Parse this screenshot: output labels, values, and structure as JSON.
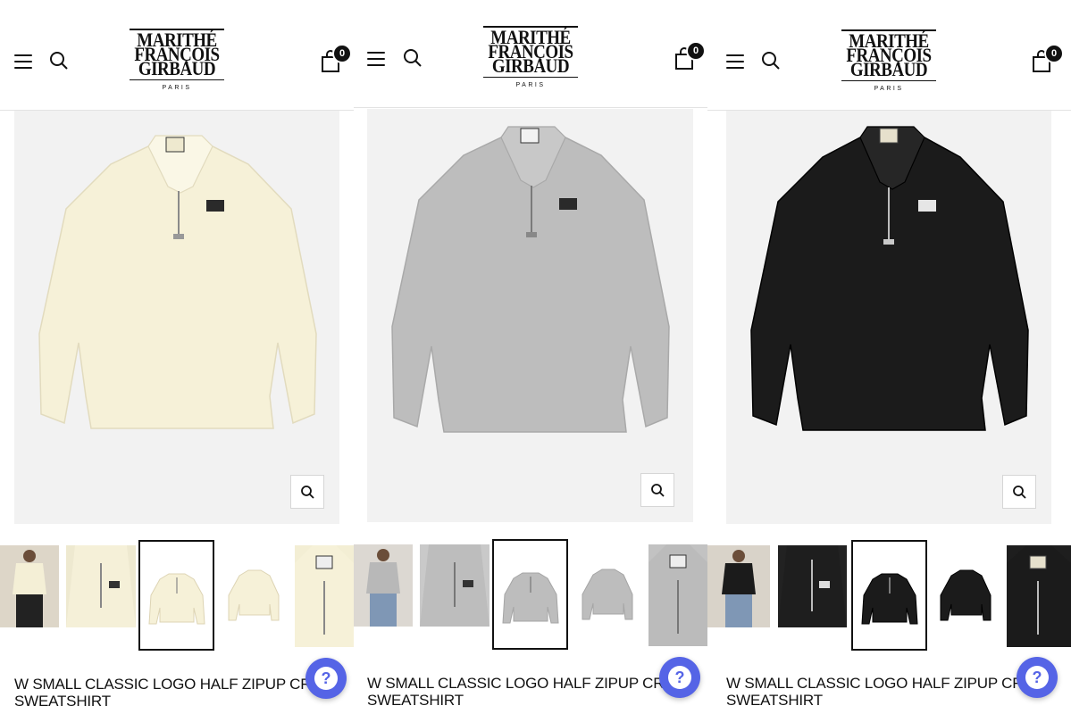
{
  "brand": {
    "line1": "MARITHÉ",
    "line2": "FRANÇOIS",
    "line3": "GIRBAUD",
    "tagline": "PARIS"
  },
  "cart": {
    "count": "0"
  },
  "colors": {
    "accent": "#5564e6",
    "cream": "#f6f1d8",
    "grey": "#b4b4b4",
    "black": "#1b1b1b",
    "image_bg": "#f2f2f2"
  },
  "panels": [
    {
      "variant": "cream",
      "title_line1": "W SMALL CLASSIC LOGO HALF ZIPUP CROP",
      "title_line2": "SWEATSHIRT"
    },
    {
      "variant": "grey",
      "title_line1": "W SMALL CLASSIC LOGO HALF ZIPUP CROP",
      "title_line2": "SWEATSHIRT"
    },
    {
      "variant": "black",
      "title_line1": "W SMALL CLASSIC LOGO HALF ZIPUP CROP",
      "title_line2": "SWEATSHIRT"
    }
  ],
  "icons": {
    "menu": "hamburger-menu-icon",
    "search": "search-icon",
    "cart": "shopping-bag-icon",
    "zoom": "zoom-icon",
    "chat": "help-chat-icon"
  }
}
